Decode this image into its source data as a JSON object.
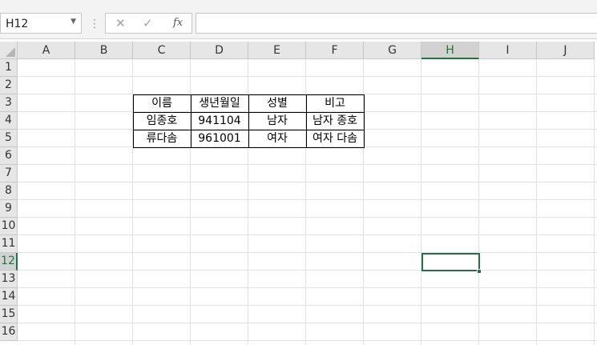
{
  "formula_bar": {
    "name_box": "H12",
    "separator_glyph": "⋮",
    "cancel_glyph": "✕",
    "enter_glyph": "✓",
    "function_glyph": "fx",
    "formula_value": ""
  },
  "columns": [
    "A",
    "B",
    "C",
    "D",
    "E",
    "F",
    "G",
    "H",
    "I",
    "J"
  ],
  "rows": [
    "1",
    "2",
    "3",
    "4",
    "5",
    "6",
    "7",
    "8",
    "9",
    "10",
    "11",
    "12",
    "13",
    "14",
    "15",
    "16"
  ],
  "active_cell": {
    "column": "H",
    "row": "12"
  },
  "table": {
    "headers": [
      "이름",
      "생년월일",
      "성별",
      "비고"
    ],
    "rows": [
      [
        "임종호",
        "941104",
        "남자",
        "남자 종호"
      ],
      [
        "류다솜",
        "961001",
        "여자",
        "여자 다솜"
      ]
    ]
  },
  "colors": {
    "selection": "#217346"
  }
}
